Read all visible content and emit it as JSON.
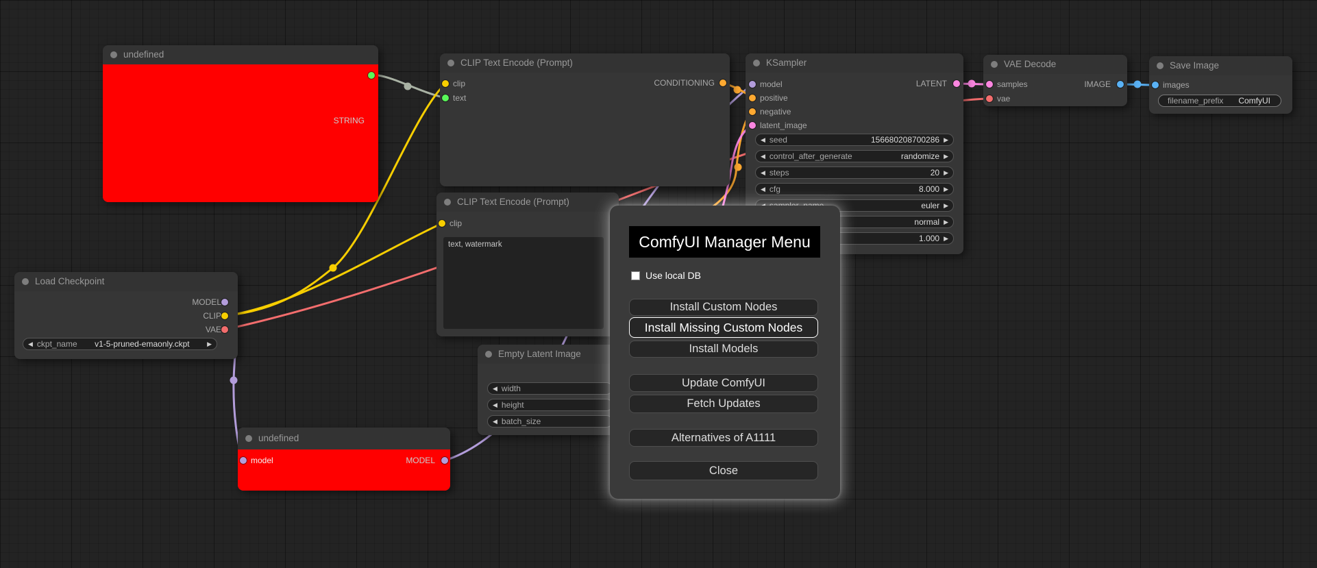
{
  "app": {
    "name": "ComfyUI"
  },
  "colors": {
    "model": "#b39ddb",
    "clip": "#f7ce00",
    "vae": "#f36d6d",
    "conditioning": "#ffa931",
    "latent": "#fb86e0",
    "image": "#5ab2f5",
    "string": "#59f759",
    "generic_link": "#a9b2a4",
    "node_error_body": "#ff0000"
  },
  "nodes": {
    "undefined_top": {
      "title": "undefined",
      "outputs": [
        {
          "label": "STRING"
        }
      ]
    },
    "load_checkpoint": {
      "title": "Load Checkpoint",
      "outputs": [
        {
          "label": "MODEL"
        },
        {
          "label": "CLIP"
        },
        {
          "label": "VAE"
        }
      ],
      "widgets": [
        {
          "label": "ckpt_name",
          "value": "v1-5-pruned-emaonly.ckpt"
        }
      ]
    },
    "clip_encode_positive": {
      "title": "CLIP Text Encode (Prompt)",
      "inputs": [
        {
          "label": "clip"
        },
        {
          "label": "text"
        }
      ],
      "outputs": [
        {
          "label": "CONDITIONING"
        }
      ]
    },
    "clip_encode_negative": {
      "title": "CLIP Text Encode (Prompt)",
      "inputs": [
        {
          "label": "clip"
        }
      ],
      "text_value": "text, watermark"
    },
    "empty_latent_image": {
      "title": "Empty Latent Image",
      "widgets": [
        {
          "label": "width",
          "value": ""
        },
        {
          "label": "height",
          "value": ""
        },
        {
          "label": "batch_size",
          "value": ""
        }
      ]
    },
    "ksampler": {
      "title": "KSampler",
      "inputs": [
        {
          "label": "model"
        },
        {
          "label": "positive"
        },
        {
          "label": "negative"
        },
        {
          "label": "latent_image"
        }
      ],
      "outputs": [
        {
          "label": "LATENT"
        }
      ],
      "widgets": [
        {
          "label": "seed",
          "value": "156680208700286"
        },
        {
          "label": "control_after_generate",
          "value": "randomize"
        },
        {
          "label": "steps",
          "value": "20"
        },
        {
          "label": "cfg",
          "value": "8.000"
        },
        {
          "label": "sampler_name",
          "value": "euler"
        },
        {
          "label": "",
          "value": "normal"
        },
        {
          "label": "",
          "value": "1.000"
        }
      ]
    },
    "vae_decode": {
      "title": "VAE Decode",
      "inputs": [
        {
          "label": "samples"
        },
        {
          "label": "vae"
        }
      ],
      "outputs": [
        {
          "label": "IMAGE"
        }
      ]
    },
    "save_image": {
      "title": "Save Image",
      "inputs": [
        {
          "label": "images"
        }
      ],
      "widgets": [
        {
          "label": "filename_prefix",
          "value": "ComfyUI"
        }
      ]
    },
    "undefined_bottom": {
      "title": "undefined",
      "inputs": [
        {
          "label": "model"
        }
      ],
      "outputs": [
        {
          "label": "MODEL"
        }
      ]
    }
  },
  "dialog": {
    "title": "ComfyUI Manager Menu",
    "use_local_db_label": "Use local DB",
    "use_local_db_checked": false,
    "buttons": [
      {
        "label": "Install Custom Nodes",
        "highlighted": false
      },
      {
        "label": "Install Missing Custom Nodes",
        "highlighted": true
      },
      {
        "label": "Install Models",
        "highlighted": false
      },
      {
        "label": "Update ComfyUI",
        "highlighted": false
      },
      {
        "label": "Fetch Updates",
        "highlighted": false
      },
      {
        "label": "Alternatives of A1111",
        "highlighted": false
      },
      {
        "label": "Close",
        "highlighted": false
      }
    ]
  }
}
